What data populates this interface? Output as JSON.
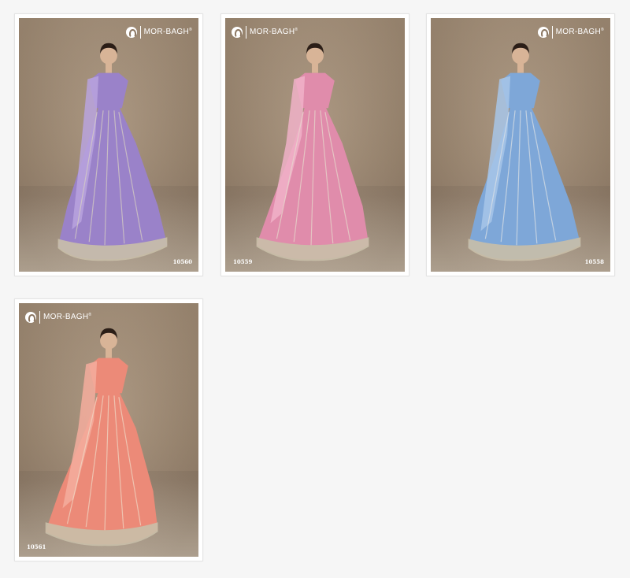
{
  "products": [
    {
      "brand": "MOR-BAGH",
      "registered": "®",
      "code": "10560",
      "color": "#9a82c9",
      "accent": "#b8a3de",
      "code_position": "bottom-right",
      "logo_position": "top-right"
    },
    {
      "brand": "MOR-BAGH",
      "registered": "®",
      "code": "10559",
      "color": "#e08cab",
      "accent": "#f0b1c8",
      "code_position": "bottom-left",
      "logo_position": "top-left"
    },
    {
      "brand": "MOR-BAGH",
      "registered": "®",
      "code": "10558",
      "color": "#7ea7d8",
      "accent": "#a7c5e9",
      "code_position": "bottom-right",
      "logo_position": "top-right"
    },
    {
      "brand": "MOR-BAGH",
      "registered": "®",
      "code": "10561",
      "color": "#ec8a78",
      "accent": "#f5ad9e",
      "code_position": "bottom-left",
      "logo_position": "top-left"
    }
  ],
  "icons": {
    "brand_logo": "peacock-logo-icon"
  }
}
